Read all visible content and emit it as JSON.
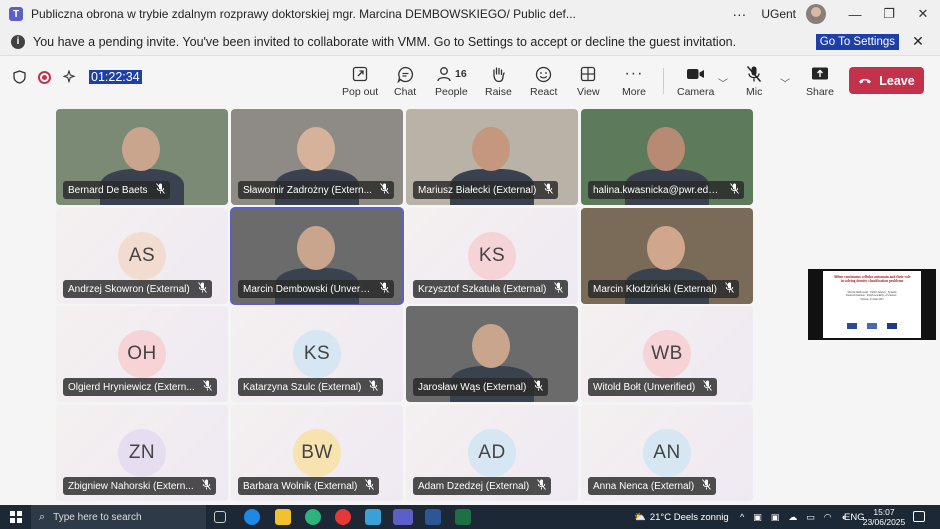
{
  "window": {
    "title": "Publiczna obrona w trybie zdalnym rozprawy doktorskiej mgr. Marcina DEMBOWSKIEGO/ Public def...",
    "user": "UGent",
    "more": "···"
  },
  "banner": {
    "text": "You have a pending invite. You've been invited to collaborate with VMM. Go to Settings to accept or decline the guest invitation.",
    "link": "Go To Settings"
  },
  "toolbar": {
    "timer": "01:22:34",
    "popout": "Pop out",
    "chat": "Chat",
    "people": "People",
    "people_count": "16",
    "raise": "Raise",
    "react": "React",
    "view": "View",
    "more": "More",
    "camera": "Camera",
    "mic": "Mic",
    "share": "Share",
    "leave": "Leave"
  },
  "participants": [
    {
      "name": "Bernard De Baets",
      "type": "video",
      "initials": "",
      "color": ""
    },
    {
      "name": "Sławomir Zadrożny (Extern...",
      "type": "video",
      "initials": "",
      "color": ""
    },
    {
      "name": "Mariusz Białecki (External)",
      "type": "video",
      "initials": "",
      "color": ""
    },
    {
      "name": "halina.kwasnicka@pwr.edu....",
      "type": "video",
      "initials": "",
      "color": ""
    },
    {
      "name": "Andrzej Skowron (External)",
      "type": "avatar",
      "initials": "AS",
      "color": "#f1dccf"
    },
    {
      "name": "Marcin Dembowski (Unverified)",
      "type": "video",
      "initials": "",
      "color": ""
    },
    {
      "name": "Krzysztof Szkatuła (External)",
      "type": "avatar",
      "initials": "KS",
      "color": "#f6d3d6"
    },
    {
      "name": "Marcin Kłodziński (External)",
      "type": "video",
      "initials": "",
      "color": ""
    },
    {
      "name": "Olgierd Hryniewicz (Extern...",
      "type": "avatar",
      "initials": "OH",
      "color": "#f6d3d6"
    },
    {
      "name": "Katarzyna Szulc (External)",
      "type": "avatar",
      "initials": "KS",
      "color": "#d6e6f2"
    },
    {
      "name": "Jarosław Wąs (External)",
      "type": "video",
      "initials": "",
      "color": ""
    },
    {
      "name": "Witold Bołt (Unverified)",
      "type": "avatar",
      "initials": "WB",
      "color": "#f6d3d6"
    },
    {
      "name": "Zbigniew Nahorski (Extern...",
      "type": "avatar",
      "initials": "ZN",
      "color": "#e6ddf0"
    },
    {
      "name": "Barbara Wolnik (External)",
      "type": "avatar",
      "initials": "BW",
      "color": "#f6e3b0"
    },
    {
      "name": "Adam Dzedzej (External)",
      "type": "avatar",
      "initials": "AD",
      "color": "#d6e6f2"
    },
    {
      "name": "Anna Nenca (External)",
      "type": "avatar",
      "initials": "AN",
      "color": "#d6e6f2"
    }
  ],
  "slide": {
    "title": "Affine continuous cellular automata and their role in solving density classification problems",
    "subtitle": "Marcin Dembowski · Public defence · Systems Research Institute · Polish Academy of Sciences · Warsaw, 23 June 2025"
  },
  "taskbar": {
    "search_placeholder": "Type here to search",
    "weather": "21°C  Deels zonnig",
    "language": "ENG",
    "time": "15:07",
    "date": "23/06/2025"
  }
}
